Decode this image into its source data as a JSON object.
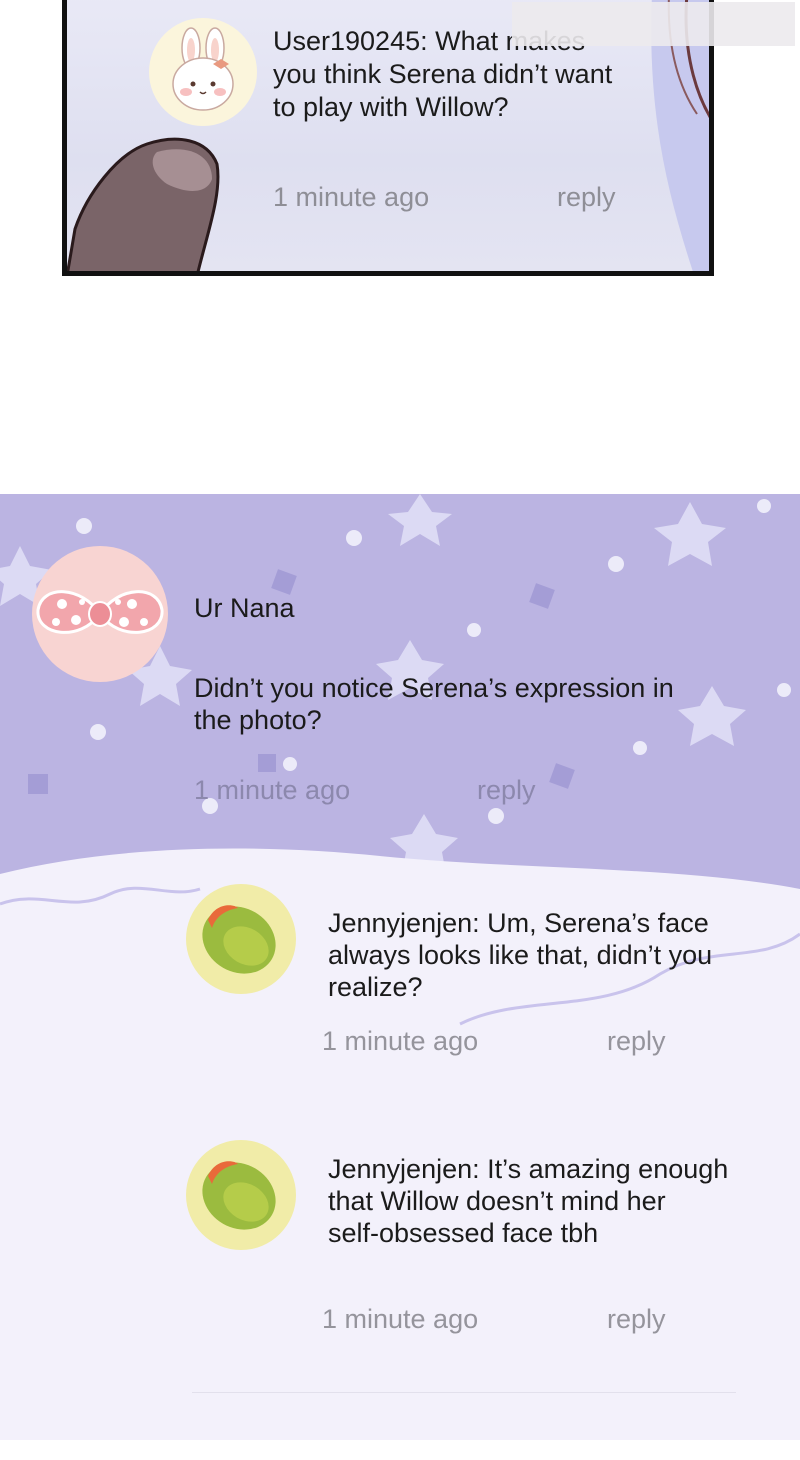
{
  "top_comment": {
    "username": "User190245:",
    "text_line1": "What makes",
    "text_line2": "you think Serena didn’t want",
    "text_line3": "to play with Willow?",
    "time": "1 minute ago",
    "reply": "reply",
    "avatar_icon": "bunny-avatar-icon"
  },
  "main_comment": {
    "username": "Ur Nana",
    "text_line1": "Didn’t you notice Serena’s expression in",
    "text_line2": "the photo?",
    "time": "1 minute ago",
    "reply": "reply",
    "avatar_icon": "pink-bow-avatar-icon"
  },
  "replies": [
    {
      "line1": "Jennyjenjen: Um, Serena’s face",
      "line2": "always looks like that, didn’t you",
      "line3": "realize?",
      "time": "1 minute ago",
      "reply": "reply",
      "avatar_icon": "papaya-avatar-icon"
    },
    {
      "line1": "Jennyjenjen: It’s amazing enough",
      "line2": "that Willow doesn’t mind her",
      "line3": "self-obsessed face tbh",
      "time": "1 minute ago",
      "reply": "reply",
      "avatar_icon": "papaya-avatar-icon"
    }
  ],
  "colors": {
    "lavender_bg": "#b9b2e0",
    "cream_bg": "#f3f1fb",
    "text": "#1b1b1b",
    "meta_text": "#8e8e96"
  }
}
